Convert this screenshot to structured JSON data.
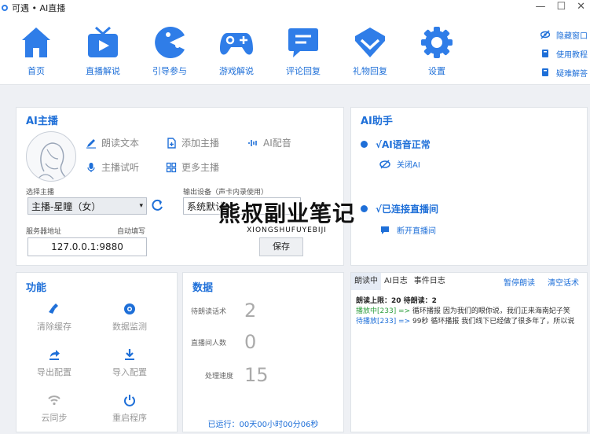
{
  "window": {
    "title": "可遇 • AI直播",
    "minimize": "—",
    "maximize": "☐",
    "close": "✕"
  },
  "toolbar": {
    "items": [
      {
        "label": "首页",
        "icon": "home-icon"
      },
      {
        "label": "直播解说",
        "icon": "tv-icon"
      },
      {
        "label": "引导参与",
        "icon": "pacman-icon"
      },
      {
        "label": "游戏解说",
        "icon": "gamepad-icon"
      },
      {
        "label": "评论回复",
        "icon": "comment-icon"
      },
      {
        "label": "礼物回复",
        "icon": "gift-icon"
      },
      {
        "label": "设置",
        "icon": "gear-icon"
      }
    ],
    "side_links": [
      "隐藏窗口",
      "使用教程",
      "疑难解答"
    ]
  },
  "anchor": {
    "title": "AI主播",
    "actions": {
      "read_text": "朗读文本",
      "add_anchor": "添加主播",
      "ai_voice": "AI配音",
      "preview": "主播试听",
      "more": "更多主播"
    },
    "select_label": "选择主播",
    "selected_anchor": "主播-星瞳（女）",
    "output_label": "输出设备（声卡内录使用）",
    "output_value": "系统默认",
    "server_label": "服务器地址",
    "auto_fill": "自动填写",
    "server_value": "127.0.0.1:9880",
    "save": "保存"
  },
  "assistant": {
    "title": "AI助手",
    "voice_status": "√AI语音正常",
    "close_ai": "关闭AI",
    "live_status": "√已连接直播间",
    "disconnect": "断开直播间"
  },
  "functions": {
    "title": "功能",
    "items": [
      {
        "label": "清除缓存",
        "icon": "broom-icon"
      },
      {
        "label": "数据监测",
        "icon": "eye-icon"
      },
      {
        "label": "导出配置",
        "icon": "export-icon"
      },
      {
        "label": "导入配置",
        "icon": "import-icon"
      },
      {
        "label": "云同步",
        "icon": "wifi-icon"
      },
      {
        "label": "重启程序",
        "icon": "power-icon"
      }
    ]
  },
  "stats": {
    "title": "数据",
    "items": [
      {
        "label": "待朗读话术",
        "value": "2"
      },
      {
        "label": "直播间人数",
        "value": "0"
      },
      {
        "label": "处理速度",
        "value": "15"
      }
    ],
    "runtime": "已运行：00天00小时00分06秒"
  },
  "logs": {
    "tabs": [
      "朗读中",
      "AI日志",
      "事件日志"
    ],
    "pause": "暂停朗读",
    "clear": "清空话术",
    "header": "朗读上限：20  待朗读：2",
    "lines": [
      {
        "status": "播放中[233] =>",
        "text": " 循环播报 因为我们的眼你说，我们正来海南妃子笑"
      },
      {
        "status": "待播放[233] =>",
        "text": " 99秒 循环播报 我们线下已经做了很多年了，所以说"
      }
    ]
  },
  "watermark": {
    "main": "熊叔副业笔记",
    "sub": "XIONGSHUFUYEBIJI"
  },
  "colors": {
    "accent": "#1e6fd8",
    "playing": "#2e9e3e"
  }
}
